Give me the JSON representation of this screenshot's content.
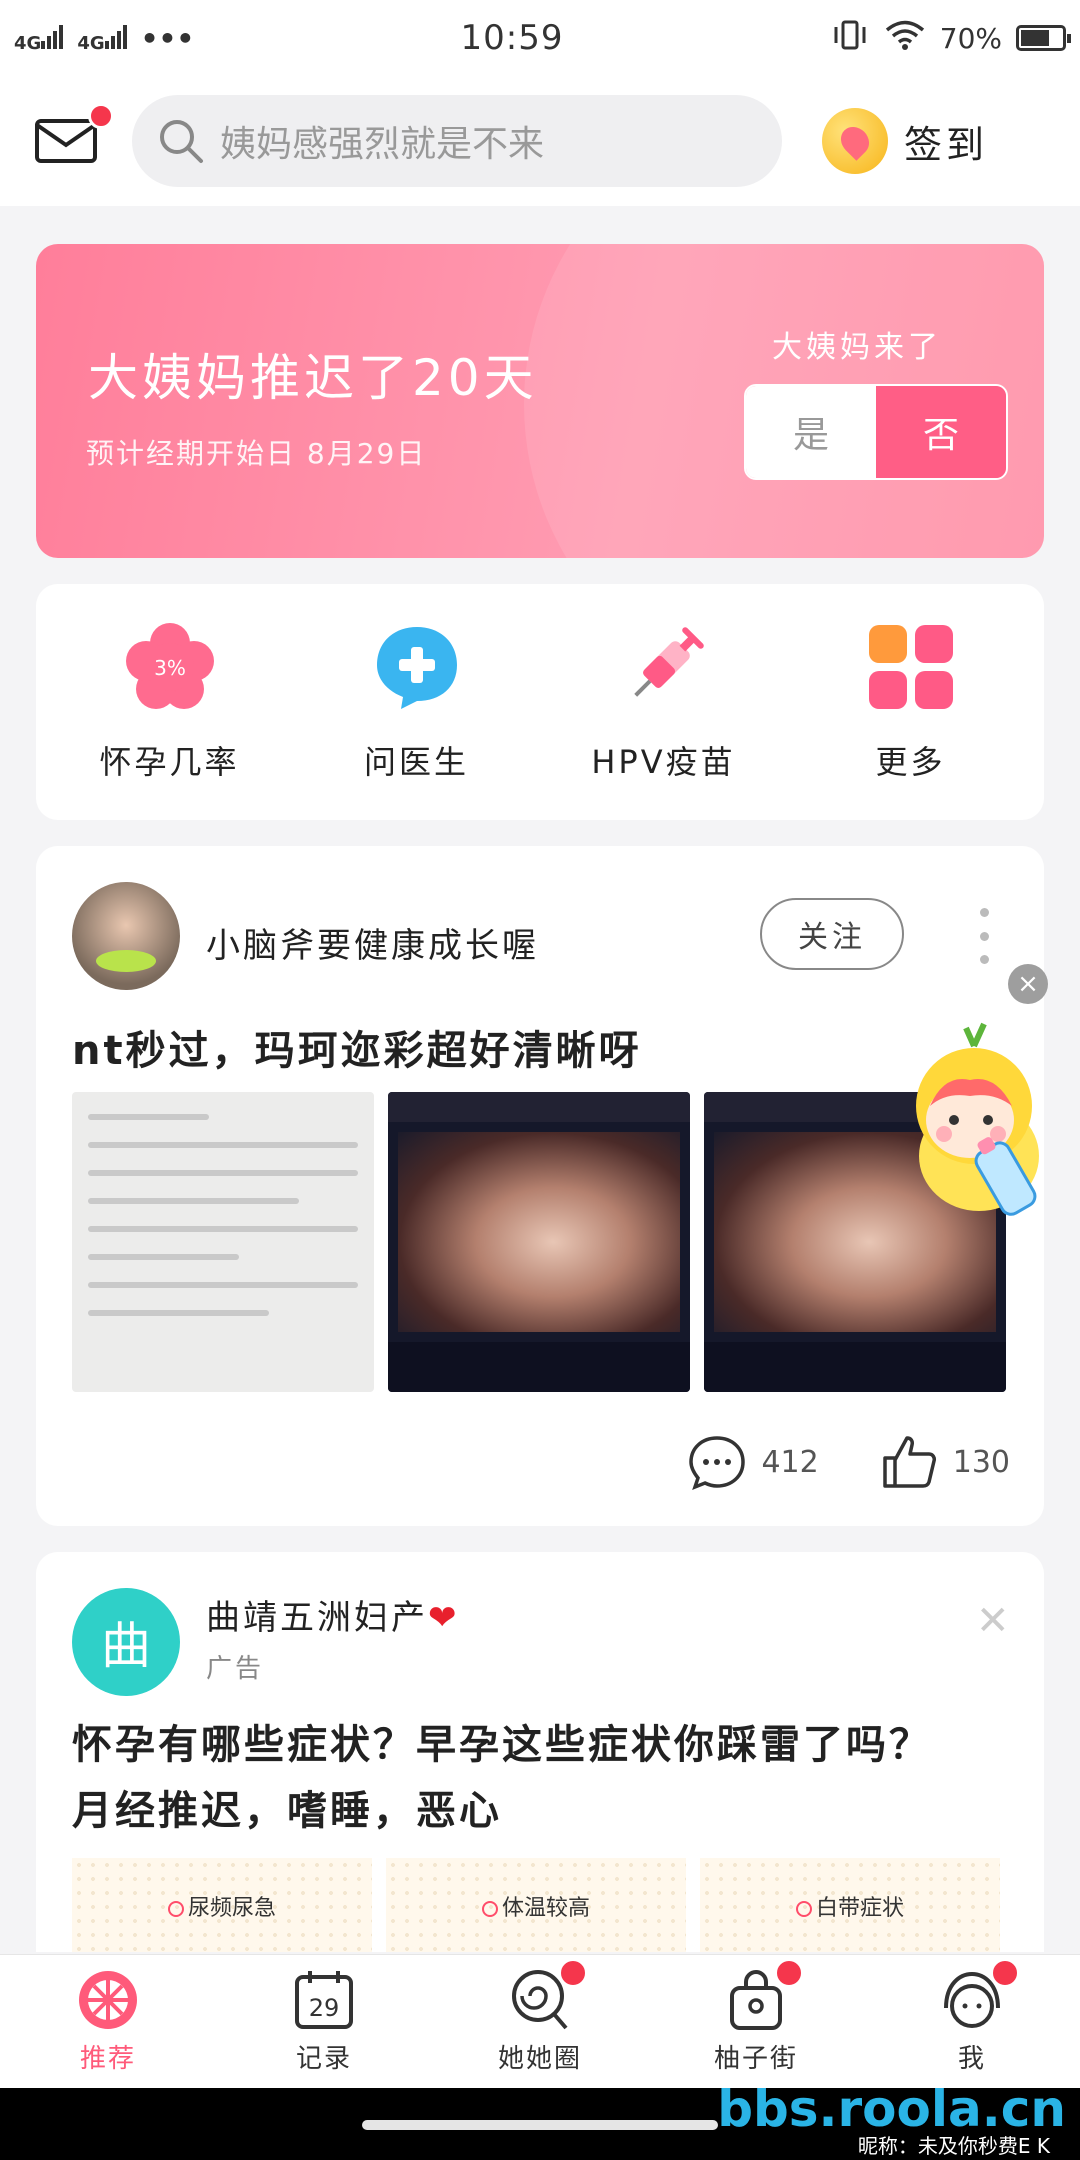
{
  "status_bar": {
    "network": [
      "4G",
      "4G"
    ],
    "time": "10:59",
    "battery": "70%",
    "battery_level": 0.7
  },
  "header": {
    "search_placeholder": "姨妈感强烈就是不来",
    "checkin_label": "签到"
  },
  "period_card": {
    "title": "大姨妈推迟了20天",
    "subtitle": "预计经期开始日 8月29日",
    "question": "大姨妈来了",
    "yes": "是",
    "no": "否"
  },
  "tools": [
    {
      "label": "怀孕几率",
      "icon_text": "3%"
    },
    {
      "label": "问医生"
    },
    {
      "label": "HPV疫苗"
    },
    {
      "label": "更多"
    }
  ],
  "post": {
    "author": "小脑斧要健康成长喔",
    "follow": "关注",
    "title": "nt秒过，玛珂迩彩超好清晰呀",
    "comments": "412",
    "likes": "130"
  },
  "ad": {
    "logo_char": "曲",
    "name": "曲靖五洲妇产",
    "heart": "❤",
    "tag": "广告",
    "title": "怀孕有哪些症状？早孕这些症状你踩雷了吗？月经推迟，嗜睡，恶心",
    "tiles": [
      "尿频尿急",
      "体温较高",
      "白带症状"
    ]
  },
  "bottom_nav": [
    {
      "label": "推荐",
      "active": true
    },
    {
      "label": "记录",
      "icon_text": "29"
    },
    {
      "label": "她她圈"
    },
    {
      "label": "柚子街"
    },
    {
      "label": "我"
    }
  ],
  "watermark": {
    "site": "bbs.roola.cn",
    "note": "昵称：未及你秒费E K"
  },
  "colors": {
    "accent": "#ff5a7a",
    "card_pink": "#ff8fa6",
    "ad_teal": "#2fd0c8"
  }
}
